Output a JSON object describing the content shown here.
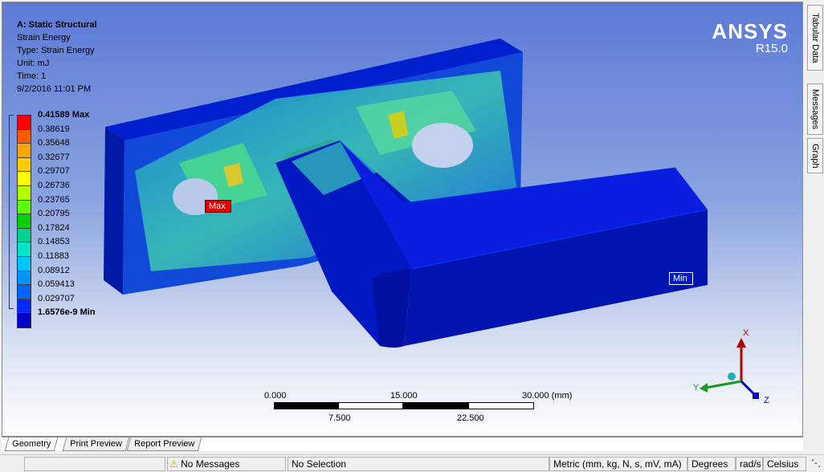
{
  "info": {
    "analysis": "A: Static Structural",
    "result_name": "Strain Energy",
    "type": "Type: Strain Energy",
    "unit": "Unit: mJ",
    "time": "Time: 1",
    "date": "9/2/2016 11:01 PM"
  },
  "legend": {
    "labels": [
      "0.41589 Max",
      "0.38619",
      "0.35648",
      "0.32677",
      "0.29707",
      "0.26736",
      "0.23765",
      "0.20795",
      "0.17824",
      "0.14853",
      "0.11883",
      "0.08912",
      "0.059413",
      "0.029707",
      "1.6576e-9 Min"
    ],
    "colors": [
      "#ff0000",
      "#ff5a00",
      "#ffa500",
      "#ffcc00",
      "#ffff00",
      "#b4ff00",
      "#5aff00",
      "#00d200",
      "#00d28c",
      "#00e6c8",
      "#00c8ff",
      "#0096ff",
      "#0064ff",
      "#0028ff",
      "#0000c8"
    ]
  },
  "logo": {
    "name": "ANSYS",
    "version": "R15.0"
  },
  "probes": {
    "max": "Max",
    "min": "Min"
  },
  "scale": {
    "top_ticks": [
      "0.000",
      "15.000",
      "30.000 (mm)"
    ],
    "bottom_ticks": [
      "7.500",
      "22.500"
    ]
  },
  "triad": {
    "x": "X",
    "y": "Y",
    "z": "Z"
  },
  "right_tabs": [
    "Tabular Data",
    "Messages",
    "Graph"
  ],
  "bottom_tabs": [
    "Geometry",
    "Print Preview",
    "Report Preview"
  ],
  "status": {
    "messages": "No Messages",
    "selection": "No Selection",
    "units": "Metric (mm, kg, N, s, mV, mA)",
    "angle": "Degrees",
    "rate": "rad/s",
    "temp": "Celsius"
  },
  "colors": {
    "body": "#0018b8",
    "body_dark": "#001080",
    "body_side": "#0014a0",
    "accent_red": "#c00000"
  }
}
